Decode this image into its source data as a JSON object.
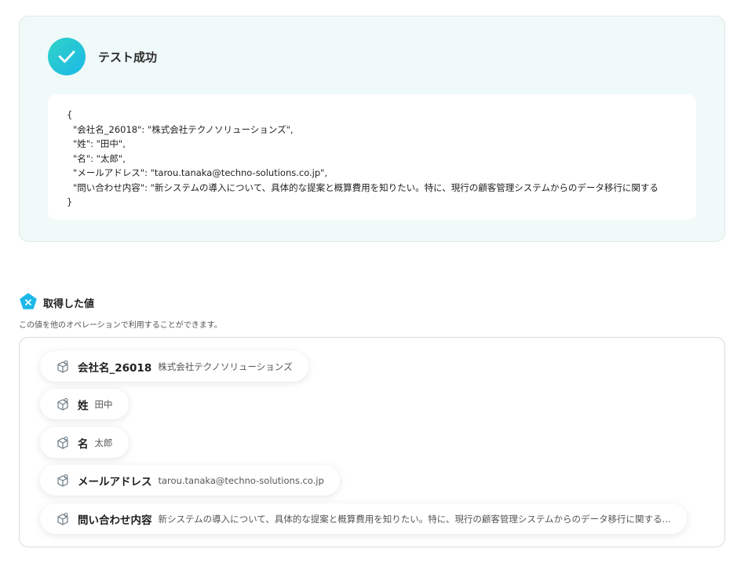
{
  "success": {
    "title": "テスト成功",
    "json_lines": [
      "{",
      "\"会社名_26018\": \"株式会社テクノソリューションズ\",",
      "\"姓\": \"田中\",",
      "\"名\": \"太郎\",",
      "\"メールアドレス\": \"tarou.tanaka@techno-solutions.co.jp\",",
      "\"問い合わせ内容\": \"新システムの導入について、具体的な提案と概算費用を知りたい。特に、現行の顧客管理システムからのデータ移行に関する",
      "}"
    ]
  },
  "acquired": {
    "title": "取得した値",
    "description": "この値を他のオペレーションで利用することができます。",
    "items": [
      {
        "key": "会社名_26018",
        "value": "株式会社テクノソリューションズ"
      },
      {
        "key": "姓",
        "value": "田中"
      },
      {
        "key": "名",
        "value": "太郎"
      },
      {
        "key": "メールアドレス",
        "value": "tarou.tanaka@techno-solutions.co.jp"
      },
      {
        "key": "問い合わせ内容",
        "value": "新システムの導入について、具体的な提案と概算費用を知りたい。特に、現行の顧客管理システムからのデータ移行に関する..."
      }
    ]
  },
  "colors": {
    "accent": "#1cb8e8",
    "success_panel_bg": "#f0faf9"
  },
  "icons": {
    "success": "check-icon",
    "acquired": "variable-pentagon-icon",
    "chip": "cube-icon"
  }
}
